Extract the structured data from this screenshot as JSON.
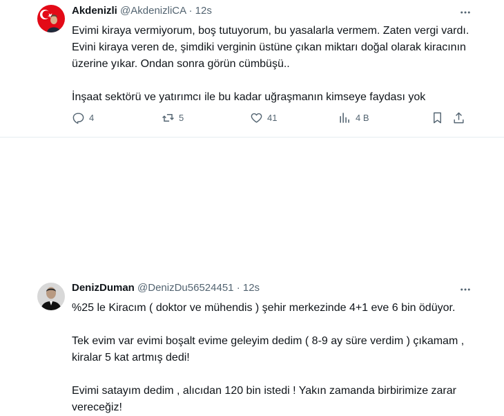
{
  "tweets": [
    {
      "name": "Akdenizli",
      "handle": "@AkdenizliCA",
      "separator": "·",
      "time": "12s",
      "paragraphs": [
        "Evimi kiraya vermiyorum, boş tutuyorum, bu yasalarla vermem. Zaten vergi vardı. Evini kiraya veren de, şimdiki verginin üstüne çıkan miktarı doğal olarak kiracının üzerine yıkar. Ondan sonra görün cümbüşü..",
        "İnşaat sektörü ve yatırımcı ile bu kadar uğraşmanın kimseye faydası yok"
      ],
      "actions": {
        "reply_count": "4",
        "retweet_count": "5",
        "like_count": "41",
        "views_count": "4 B"
      }
    },
    {
      "name": "DenizDuman",
      "handle": "@DenizDu56524451",
      "separator": "·",
      "time": "12s",
      "paragraphs": [
        "%25 le  Kiracım ( doktor ve mühendis ) şehir merkezinde 4+1 eve 6 bin ödüyor.",
        "Tek evim var evimi boşalt evime geleyim dedim ( 8-9 ay süre verdim ) çıkamam , kiralar 5 kat artmış dedi!",
        "Evimi satayım dedim , alıcıdan 120 bin istedi ! Yakın zamanda birbirimize zarar vereceğiz!"
      ]
    }
  ],
  "icons": {
    "more": "more-horizontal-icon",
    "reply": "reply-icon",
    "retweet": "retweet-icon",
    "like": "heart-icon",
    "views": "analytics-icon",
    "bookmark": "bookmark-icon",
    "share": "share-icon"
  },
  "colors": {
    "text": "#0f1419",
    "secondary": "#536471",
    "divider": "#e6ecf0",
    "flag_red": "#e30a17"
  }
}
